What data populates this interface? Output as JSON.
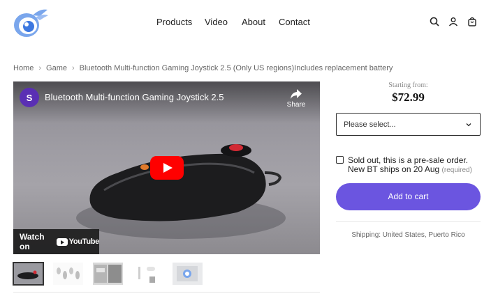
{
  "header": {
    "nav": [
      "Products",
      "Video",
      "About",
      "Contact"
    ],
    "icons": [
      "search-icon",
      "account-icon",
      "cart-icon"
    ]
  },
  "breadcrumb": {
    "items": [
      "Home",
      "Game",
      "Bluetooth Multi-function Gaming Joystick 2.5 (Only US regions)Includes replacement battery"
    ]
  },
  "video": {
    "channel_initial": "S",
    "title": "Bluetooth Multi-function Gaming Joystick 2.5",
    "share_label": "Share",
    "watch_on_label": "Watch on",
    "youtube_label": "YouTube"
  },
  "gallery": {
    "thumbnail_count": 5,
    "active_index": 0
  },
  "product": {
    "starting_label": "Starting from:",
    "price": "$72.99",
    "select_placeholder": "Please select...",
    "preorder_line1": "Sold out, this is a pre-sale order.",
    "preorder_line2": "New BT ships on 20 Aug",
    "required_label": "(required)",
    "add_to_cart": "Add to cart",
    "shipping": "Shipping: United States, Puerto Rico"
  },
  "colors": {
    "accent": "#6b55e0",
    "channel_avatar": "#5a2fb4",
    "play_button": "#ff0000"
  }
}
